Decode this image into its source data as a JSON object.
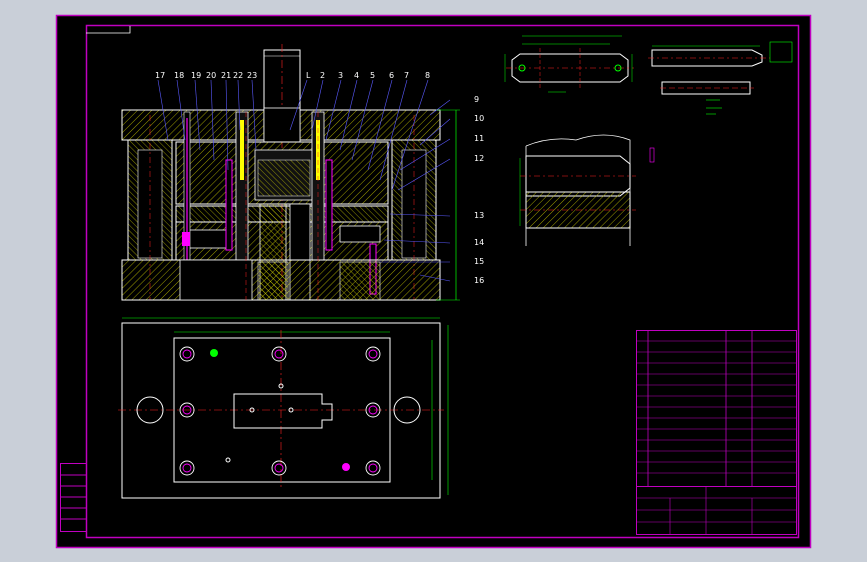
{
  "colors": {
    "background": "#c9cfd8",
    "sheet": "#000000",
    "frame": "#c000c0",
    "outline": "#ffffff",
    "centerline": "#ff2020",
    "dimension": "#00ff00",
    "hatch": "#ffff00",
    "accent": "#ff00ff",
    "leader": "#5a5aff"
  },
  "drawing": {
    "part_numbers_top": [
      "17",
      "18",
      "19",
      "20",
      "21",
      "22",
      "23",
      "L",
      "2",
      "3",
      "4",
      "5",
      "6",
      "7",
      "8"
    ],
    "part_numbers_right": [
      "9",
      "10",
      "11",
      "12",
      "13",
      "14",
      "15",
      "16"
    ]
  },
  "left_table": {
    "rows": [
      "",
      "",
      "",
      "",
      "",
      ""
    ]
  },
  "title_block": {
    "rows": [
      {
        "label": "",
        "value": ""
      },
      {
        "label": "",
        "value": ""
      },
      {
        "label": "",
        "value": ""
      },
      {
        "label": "",
        "value": ""
      },
      {
        "label": "",
        "value": ""
      },
      {
        "label": "",
        "value": ""
      },
      {
        "label": "",
        "value": ""
      },
      {
        "label": "",
        "value": ""
      },
      {
        "label": "",
        "value": ""
      },
      {
        "label": "",
        "value": ""
      },
      {
        "label": "",
        "value": ""
      },
      {
        "label": "",
        "value": ""
      },
      {
        "label": "",
        "value": ""
      },
      {
        "label": "",
        "value": ""
      }
    ]
  }
}
